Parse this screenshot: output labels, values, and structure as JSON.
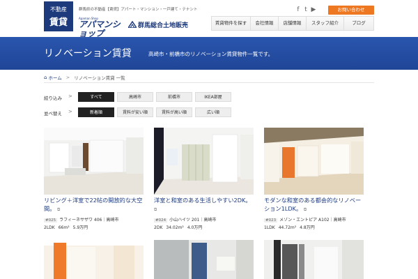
{
  "header": {
    "badge_line1": "不動産",
    "badge_line2": "賃貸",
    "tagline": "群馬県の不動産【賃貸】アパート・マンション・一戸建て・テナント",
    "logo1_sub": "Apaman Shop",
    "logo1_main": "アパマンショップ",
    "logo2_text": "群馬総合土地販売",
    "sns": [
      "f",
      "t",
      "▶"
    ],
    "contact_label": "お問い合わせ",
    "nav": [
      "賃貸物件を探す",
      "会社情報",
      "店舗情報",
      "スタッフ紹介",
      "ブログ"
    ]
  },
  "banner": {
    "title": "リノベーション賃貸",
    "subtitle": "高崎市・前橋市のリノベーション賃貸物件一覧です。"
  },
  "breadcrumb": {
    "home": "ホーム",
    "separator": ">",
    "current": "リノベーション賃貸 一覧"
  },
  "filters": {
    "narrow_label": "絞り込み",
    "narrow": [
      "すべて",
      "高崎市",
      "前橋市",
      "IKEA部屋"
    ],
    "sort_label": "並べ替え",
    "sort": [
      "新着順",
      "賃料が安い順",
      "賃料が高い順",
      "広い順"
    ],
    "arrow": ">"
  },
  "cards": [
    {
      "title": "リビング＋洋室で22帖の開放的な大空間。",
      "ext_icon": "external-link-icon",
      "num": "#025",
      "name": "ラフィーネサザワ 406｜高崎市",
      "layout": "2LDK",
      "area": "66m²",
      "rent": "5.9万円"
    },
    {
      "title": "洋室と和室のある生活しやすい2DK。",
      "ext_icon": "external-link-icon",
      "num": "#024",
      "name": "小山ハイツ 201｜高崎市",
      "layout": "2DK",
      "area": "34.02m²",
      "rent": "4.0万円"
    },
    {
      "title": "モダンな和室のある都会的なリノベーション1LDK。",
      "ext_icon": "external-link-icon",
      "num": "#023",
      "name": "メゾン・エントピア A102｜高崎市",
      "layout": "1LDK",
      "area": "44.72m²",
      "rent": "4.8万円"
    }
  ],
  "colors": {
    "brand_navy": "#1d3a7d",
    "banner_blue": "#20479c",
    "contact_orange": "#ee7721",
    "active_chip": "#222222"
  }
}
